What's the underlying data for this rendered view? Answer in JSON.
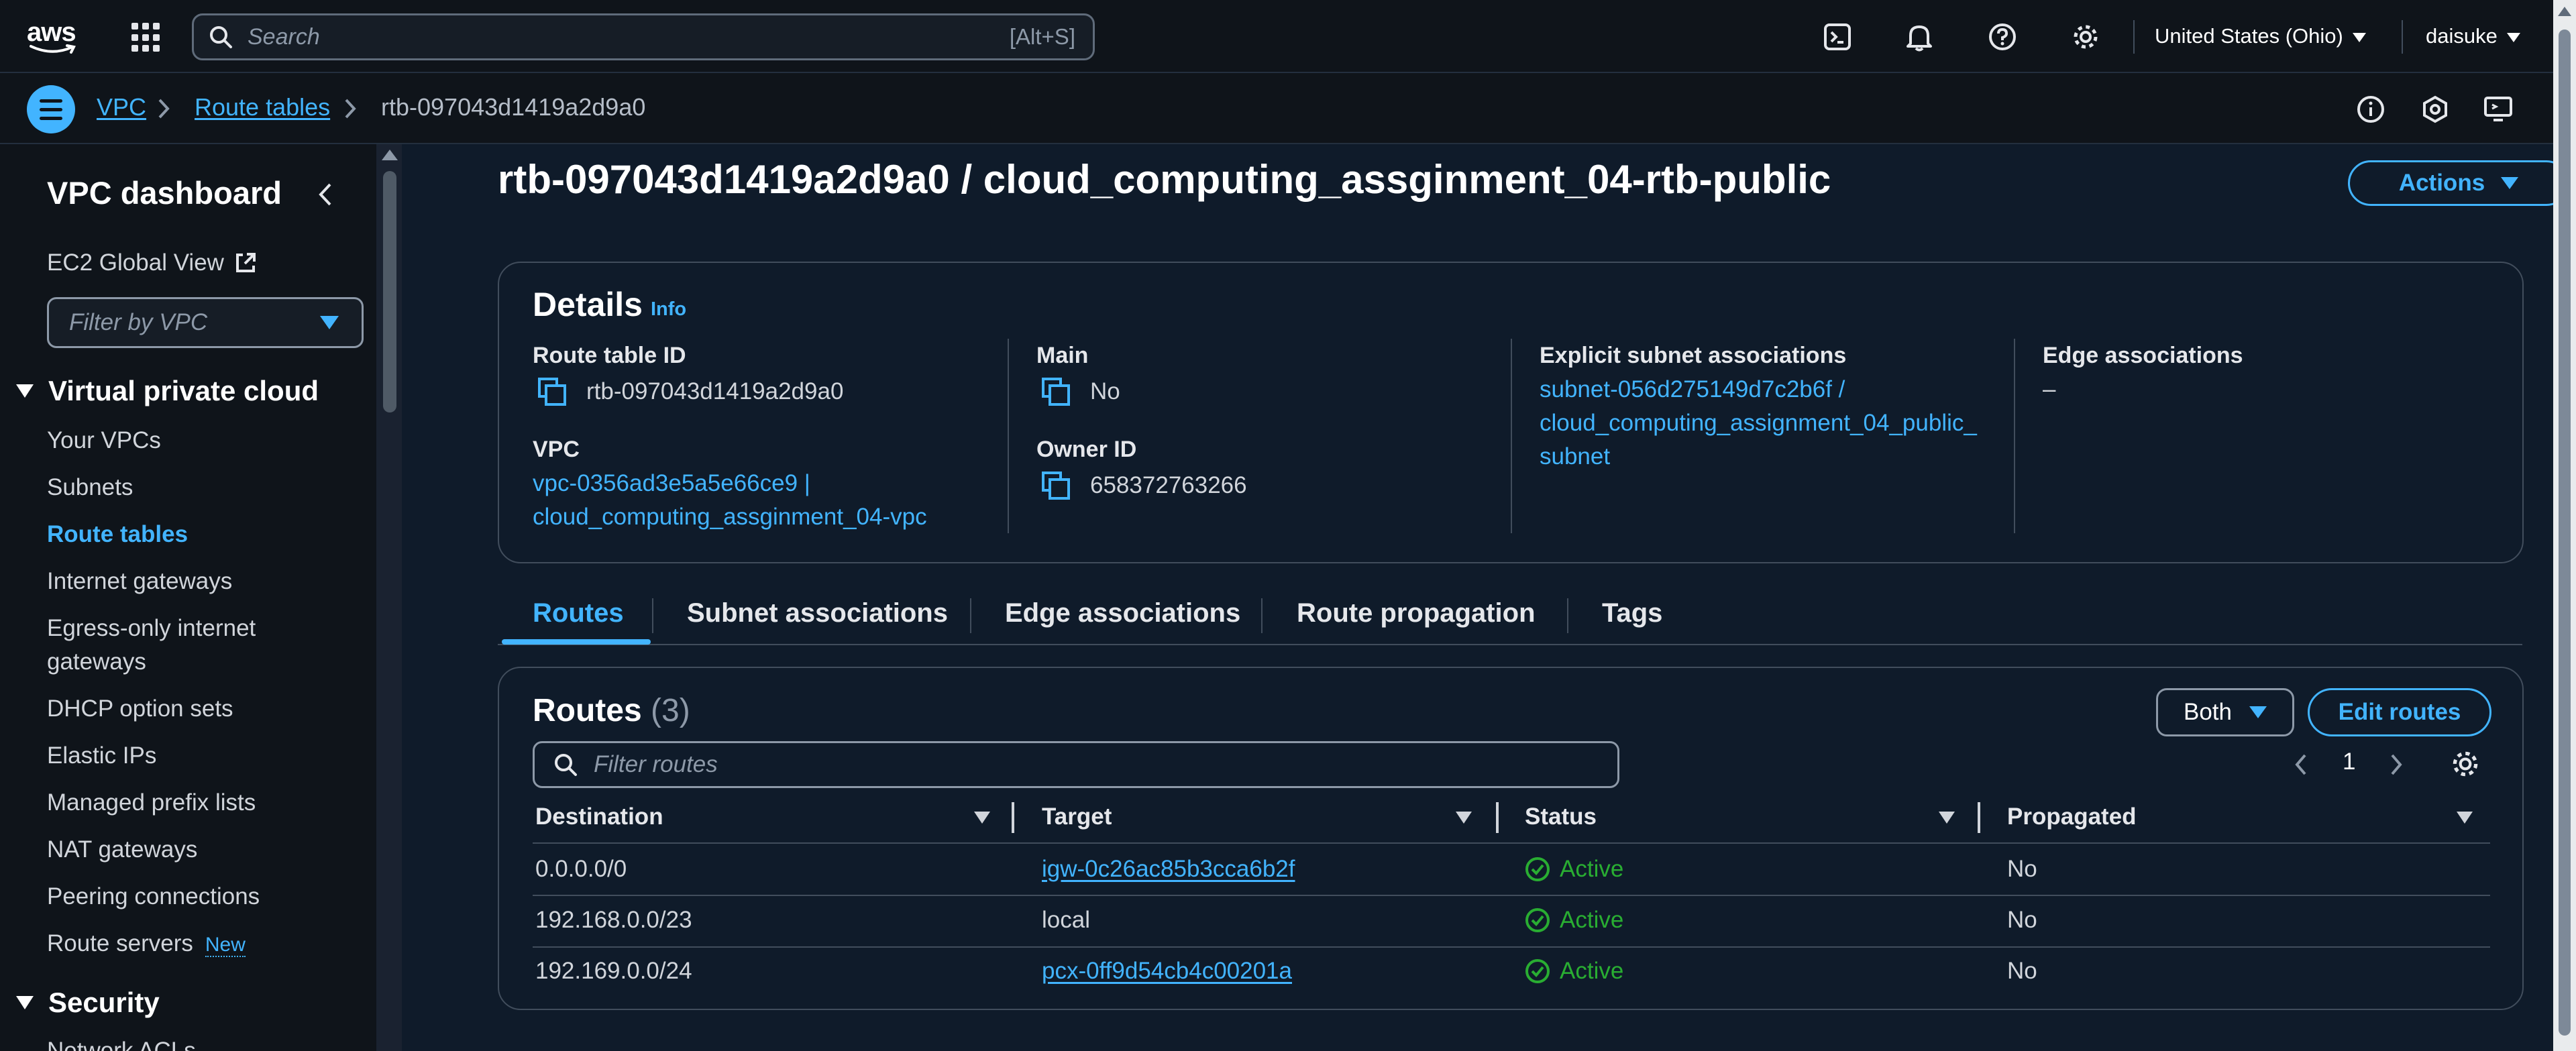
{
  "topnav": {
    "logo_text": "aws",
    "search_placeholder": "Search",
    "search_shortcut": "[Alt+S]",
    "region": "United States (Ohio)",
    "user": "daisuke",
    "icons": [
      "cloudshell-icon",
      "bell-icon",
      "help-icon",
      "gear-icon"
    ]
  },
  "breadcrumb": {
    "items": [
      "VPC",
      "Route tables",
      "rtb-097043d1419a2d9a0"
    ]
  },
  "sidebar": {
    "title": "VPC dashboard",
    "ec2_global_view": "EC2 Global View",
    "filter_placeholder": "Filter by VPC",
    "section_vpc": "Virtual private cloud",
    "items": [
      "Your VPCs",
      "Subnets",
      "Route tables",
      "Internet gateways",
      "Egress-only internet",
      "gateways",
      "DHCP option sets",
      "Elastic IPs",
      "Managed prefix lists",
      "NAT gateways",
      "Peering connections",
      "Route servers"
    ],
    "new_badge": "New",
    "section_security": "Security",
    "partial_item": "Network ACLs"
  },
  "page": {
    "title": "rtb-097043d1419a2d9a0 / cloud_computing_assginment_04-rtb-public",
    "actions_label": "Actions"
  },
  "details": {
    "heading": "Details",
    "info": "Info",
    "route_table_id_label": "Route table ID",
    "route_table_id": "rtb-097043d1419a2d9a0",
    "vpc_label": "VPC",
    "vpc_line1": "vpc-0356ad3e5a5e66ce9 |",
    "vpc_line2": "cloud_computing_assginment_04-vpc",
    "main_label": "Main",
    "main_value": "No",
    "owner_label": "Owner ID",
    "owner_value": "658372763266",
    "subnet_assoc_label": "Explicit subnet associations",
    "subnet_line1": "subnet-056d275149d7c2b6f /",
    "subnet_line2": "cloud_computing_assignment_04_public_",
    "subnet_line3": "subnet",
    "edge_label": "Edge associations",
    "edge_value": "–"
  },
  "tabs": [
    "Routes",
    "Subnet associations",
    "Edge associations",
    "Route propagation",
    "Tags"
  ],
  "routes": {
    "heading": "Routes",
    "count": "(3)",
    "both_label": "Both",
    "edit_label": "Edit routes",
    "filter_placeholder": "Filter routes",
    "page": "1",
    "columns": [
      "Destination",
      "Target",
      "Status",
      "Propagated"
    ],
    "rows": [
      {
        "destination": "0.0.0.0/0",
        "target": "igw-0c26ac85b3cca6b2f",
        "status": "Active",
        "propagated": "No"
      },
      {
        "destination": "192.168.0.0/23",
        "target": "local",
        "status": "Active",
        "propagated": "No"
      },
      {
        "destination": "192.169.0.0/24",
        "target": "pcx-0ff9d54cb4c00201a",
        "status": "Active",
        "propagated": "No"
      }
    ]
  },
  "colors": {
    "accent": "#42b4ff",
    "success": "#29ad32",
    "background": "#0f1b2a",
    "chrome": "#0f141a"
  }
}
